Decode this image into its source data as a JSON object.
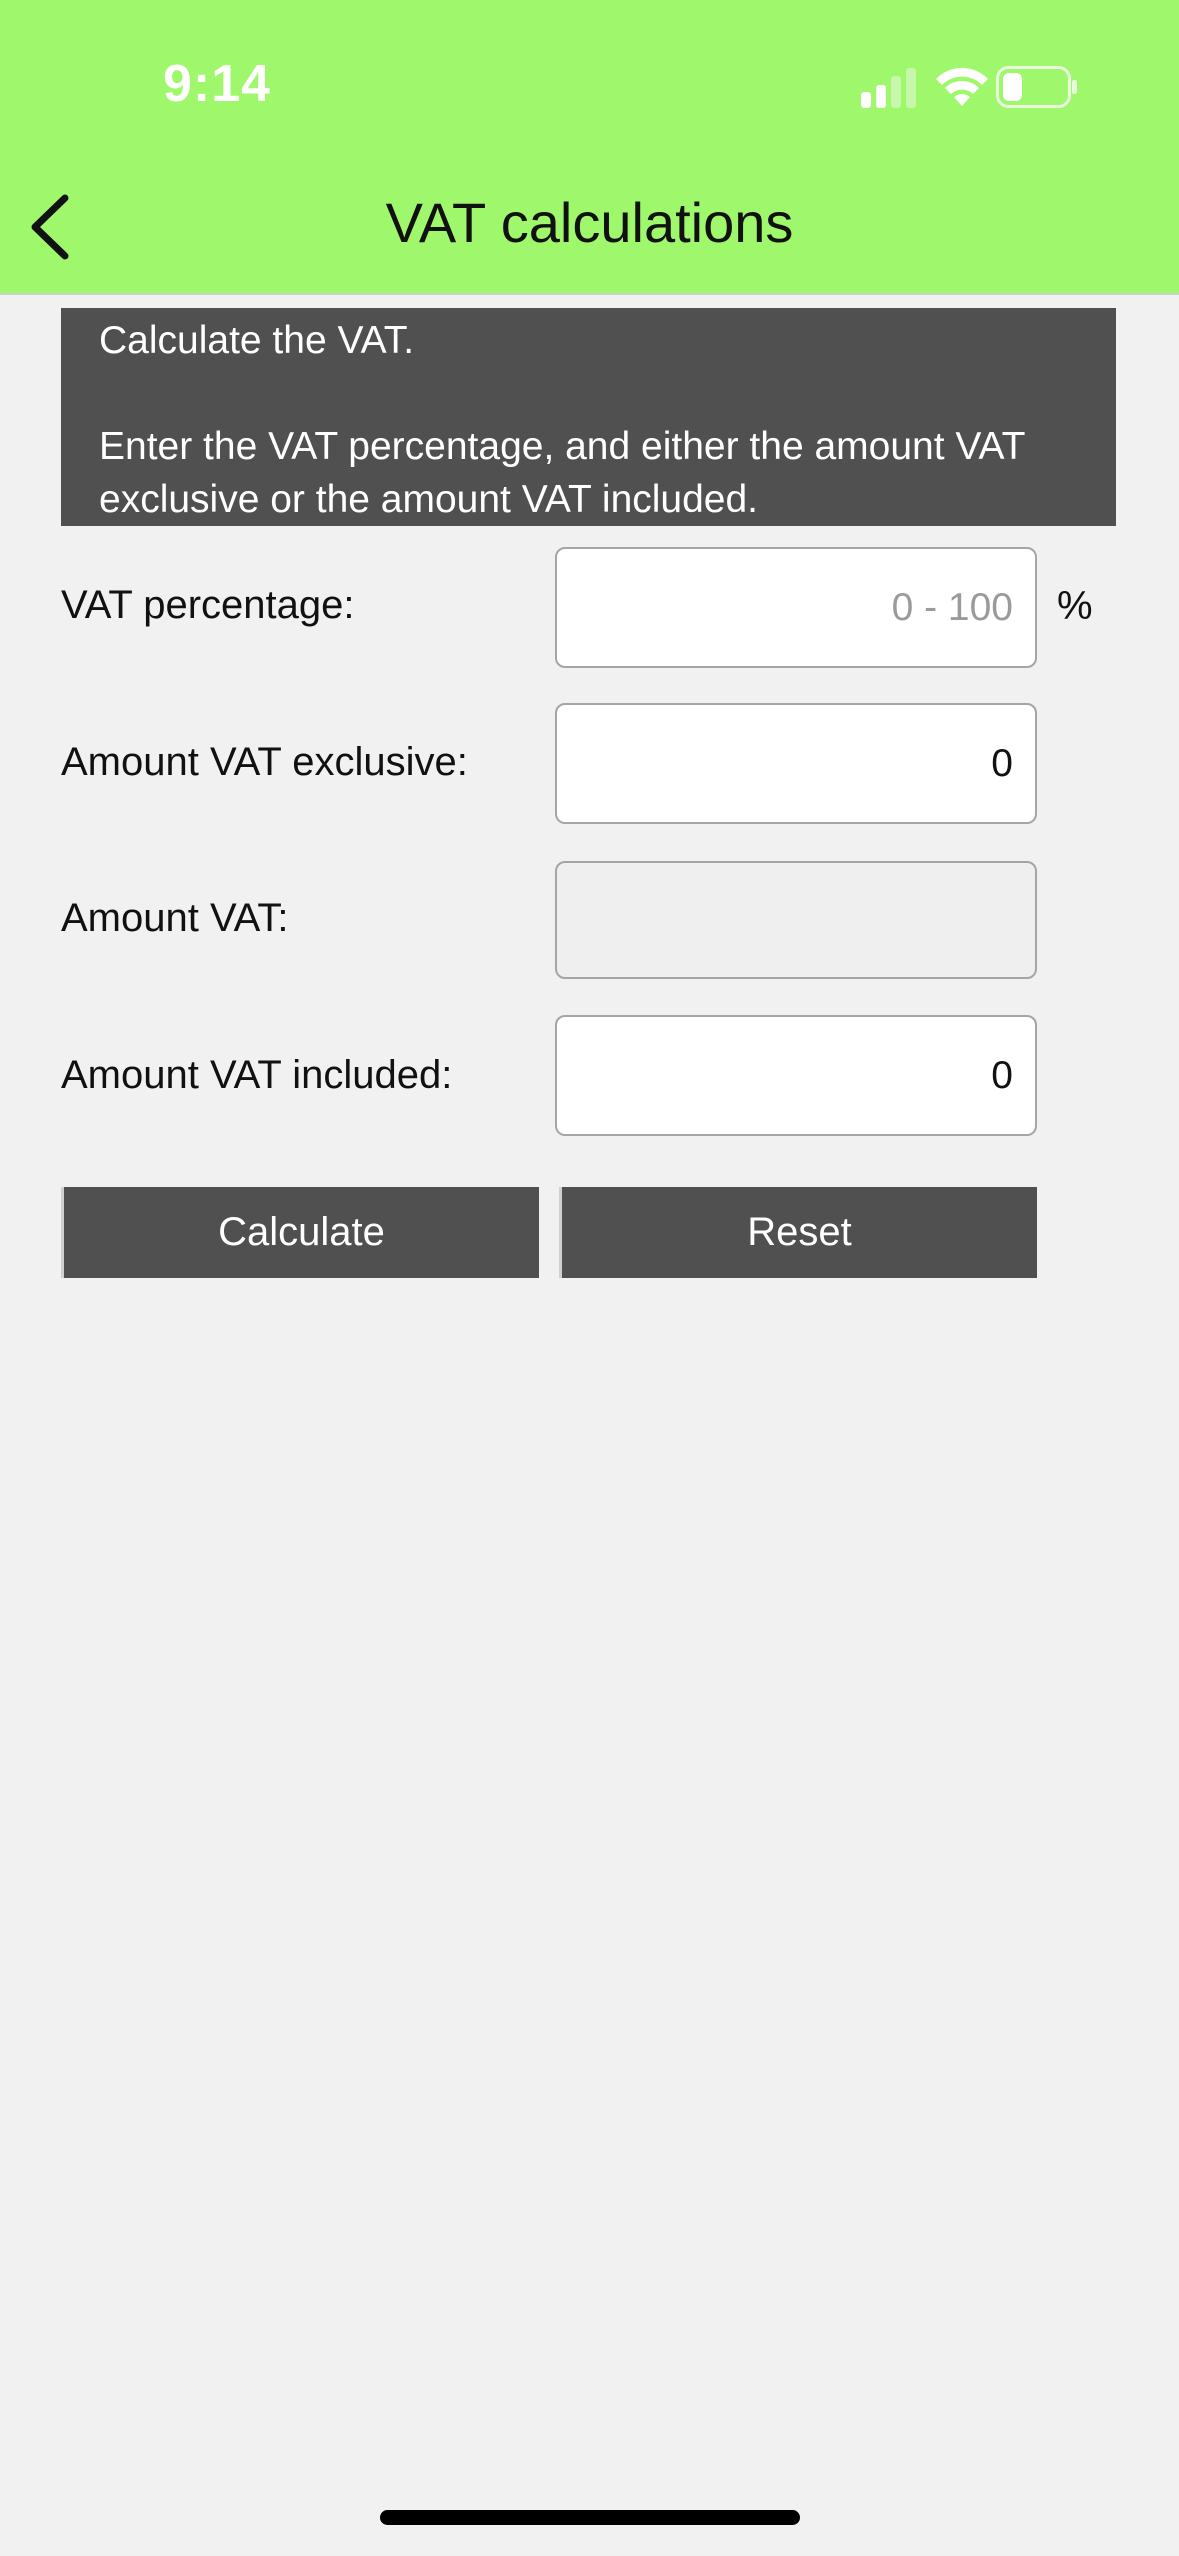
{
  "status_bar": {
    "time": "9:14"
  },
  "nav": {
    "title": "VAT calculations",
    "back_icon": "chevron-left-icon"
  },
  "info": {
    "line1": "Calculate the VAT.",
    "line2": "Enter the VAT percentage, and either the amount VAT exclusive or the amount VAT included."
  },
  "form": {
    "vat_percentage": {
      "label": "VAT percentage:",
      "value": "",
      "placeholder": "0 - 100",
      "unit": "%"
    },
    "amount_exclusive": {
      "label": "Amount VAT exclusive:",
      "value": "0"
    },
    "amount_vat": {
      "label": "Amount VAT:",
      "value": ""
    },
    "amount_included": {
      "label": "Amount VAT included:",
      "value": "0"
    }
  },
  "buttons": {
    "calculate": "Calculate",
    "reset": "Reset"
  },
  "colors": {
    "header_bg": "#9ff76c",
    "panel_bg": "#505050",
    "page_bg": "#f1f1f1"
  }
}
